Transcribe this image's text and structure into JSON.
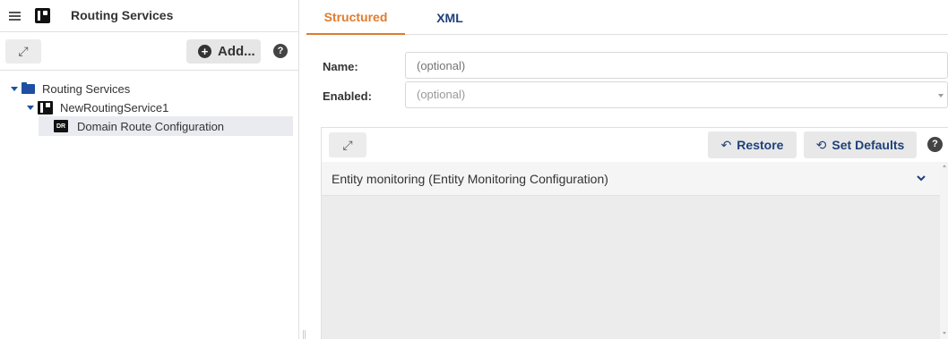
{
  "app": {
    "title": "Routing Services",
    "menu_icon": "hamburger-icon",
    "logo_icon": "routing-services-logo"
  },
  "left_toolbar": {
    "expand_icon": "expand-icon",
    "expand_glyph": "⤢",
    "add_label": "Add...",
    "add_glyph": "+",
    "help_glyph": "?"
  },
  "tree": {
    "items": [
      {
        "label": "Routing Services",
        "icon": "folder-open-icon",
        "expanded": true
      },
      {
        "label": "NewRoutingService1",
        "icon": "routing-service-icon",
        "expanded": true
      },
      {
        "label": "Domain Route Configuration",
        "icon": "domain-route-icon",
        "badge": "DR",
        "selected": true
      }
    ]
  },
  "tabs": [
    {
      "label": "Structured",
      "active": true
    },
    {
      "label": "XML",
      "active": false
    }
  ],
  "form": {
    "name_label": "Name:",
    "name_placeholder": "(optional)",
    "enabled_label": "Enabled:",
    "enabled_placeholder": "(optional)"
  },
  "panel": {
    "expand_glyph": "⤢",
    "restore_label": "Restore",
    "restore_glyph": "↶",
    "set_defaults_label": "Set Defaults",
    "set_defaults_glyph": "⟲",
    "help_glyph": "?",
    "section_title": "Entity monitoring (Entity Monitoring Configuration)",
    "section_expanded": false
  },
  "colors": {
    "accent_active_tab": "#e07b2d",
    "primary_text": "#1e3f7a",
    "tree_icon": "#1e4fa3",
    "selected_row": "#e9ebf0"
  }
}
